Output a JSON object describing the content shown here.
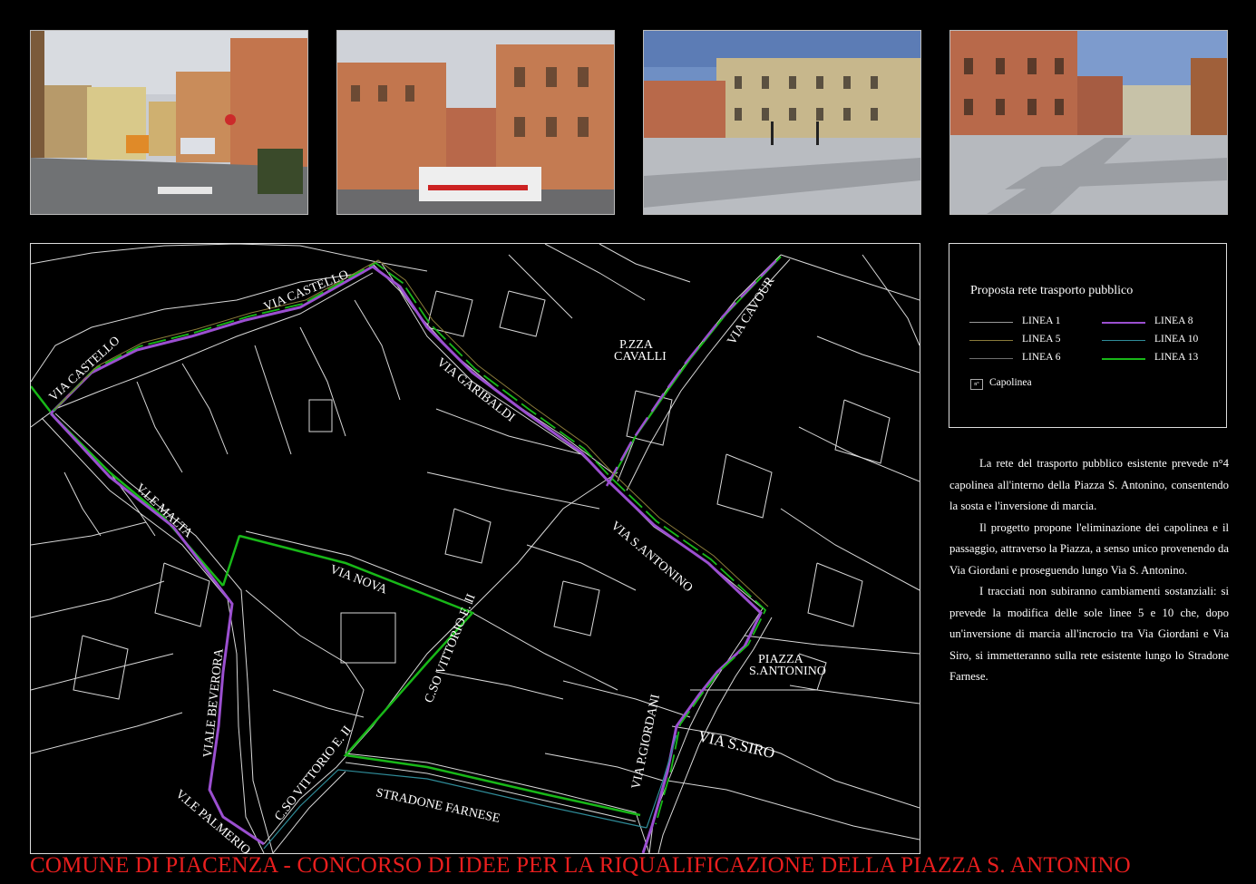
{
  "legend": {
    "title": "Proposta rete trasporto pubblico",
    "lines": [
      {
        "label": "LINEA 1",
        "color": "#9a9a9a"
      },
      {
        "label": "LINEA 5",
        "color": "#8a7a3a"
      },
      {
        "label": "LINEA 6",
        "color": "#6f6f6f"
      },
      {
        "label": "LINEA 8",
        "color": "#9b4fd0"
      },
      {
        "label": "LINEA 10",
        "color": "#2f8c99"
      },
      {
        "label": "LINEA 13",
        "color": "#18b818"
      }
    ],
    "terminal_marker": "n°",
    "terminal_label": "Capolinea"
  },
  "description": {
    "paragraphs": [
      "La rete del trasporto pubblico esistente prevede n°4 capolinea all'interno della Piazza S. Antonino, consentendo la sosta e l'inversione di marcia.",
      "Il progetto propone l'eliminazione dei capolinea e il passaggio, attraverso la Piazza, a senso unico provenendo da Via Giordani e proseguendo lungo Via S. Antonino.",
      "I tracciati non subiranno cambiamenti sostanziali: si prevede la modifica delle sole linee 5 e 10 che, dopo un'inversione di marcia all'incrocio tra Via Giordani e Via Siro, si immetteranno sulla rete esistente lungo lo Stradone Farnese."
    ]
  },
  "map": {
    "labels": {
      "via_castello_1": "VIA CASTELLO",
      "via_castello_2": "VIA CASTELLO",
      "via_garibaldi": "VIA GARIBALDI",
      "pzza_cavalli_1": "P.ZZA",
      "pzza_cavalli_2": "CAVALLI",
      "via_cavour": "VIA CAVOUR",
      "vle_malta": "V.LE MALTA",
      "via_nova": "VIA NOVA",
      "cso_vittorio_1": "C.SO VITTORIO E. II",
      "via_santonino": "VIA S.ANTONINO",
      "piazza_1": "PIAZZA",
      "piazza_2": "S.ANTONINO",
      "viale_beverora": "VIALE BEVERORA",
      "via_pgiordani": "VIA P.GIORDANI",
      "via_ssiro": "VIA S.SIRO",
      "vle_palmerio": "V.LE PALMERIO",
      "cso_vittorio_2": "C.SO VITTORIO E. II",
      "stradone_farnese": "STRADONE FARNESE"
    }
  },
  "footer": {
    "title": "COMUNE DI PIACENZA - CONCORSO DI IDEE PER LA RIQUALIFICAZIONE DELLA PIAZZA S. ANTONINO"
  }
}
